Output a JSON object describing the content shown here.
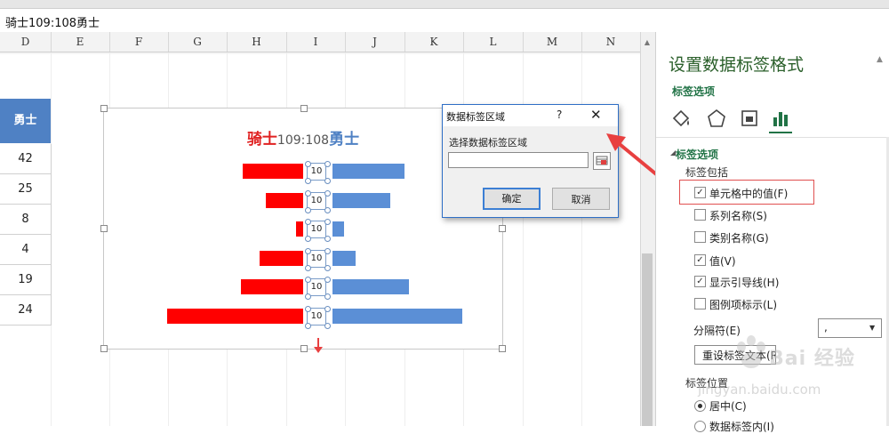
{
  "formula_bar": {
    "text": "骑士109:108勇士"
  },
  "columns": [
    "D",
    "E",
    "F",
    "G",
    "H",
    "I",
    "J",
    "K",
    "L",
    "M",
    "N"
  ],
  "sheet": {
    "header_cell": "勇士",
    "values": [
      "42",
      "25",
      "8",
      "4",
      "19",
      "24"
    ]
  },
  "chart": {
    "title_left": "骑士",
    "title_mid": "109:108",
    "title_right": "勇士",
    "label_text": "10"
  },
  "chart_data": {
    "type": "bar",
    "title": "骑士109:108勇士",
    "orientation": "horizontal-butterfly",
    "series": [
      {
        "name": "骑士",
        "color": "#ff0000",
        "values": [
          26,
          16,
          3,
          19,
          27,
          59
        ]
      },
      {
        "name": "勇士",
        "color": "#5b8fd6",
        "values": [
          31,
          25,
          5,
          10,
          33,
          56
        ]
      }
    ],
    "data_labels": [
      "10",
      "10",
      "10",
      "10",
      "10",
      "10"
    ],
    "legend": "none",
    "grid": false
  },
  "dialog": {
    "title": "数据标签区域",
    "help": "?",
    "close": "✕",
    "prompt": "选择数据标签区域",
    "input_value": "",
    "ok": "确定",
    "cancel": "取消"
  },
  "panel": {
    "title": "设置数据标签格式",
    "subtab": "标签选项",
    "section": "标签选项",
    "include_label": "标签包括",
    "options": [
      {
        "label": "单元格中的值(F)",
        "checked": true
      },
      {
        "label": "系列名称(S)",
        "checked": false
      },
      {
        "label": "类别名称(G)",
        "checked": false
      },
      {
        "label": "值(V)",
        "checked": true
      },
      {
        "label": "显示引导线(H)",
        "checked": true
      },
      {
        "label": "图例项标示(L)",
        "checked": false
      }
    ],
    "separator_label": "分隔符(E)",
    "separator_value": ",",
    "reset_label": "重设标签文本(R)",
    "position_label": "标签位置",
    "position_options": [
      {
        "label": "居中(C)",
        "selected": true
      },
      {
        "label": "数据标签内(I)",
        "selected": false
      }
    ]
  },
  "watermark": {
    "brand": "Bai 经验",
    "url": "jingyan.baidu.com"
  },
  "colors": {
    "accent": "#217346",
    "dialog_border": "#2f6fc6",
    "arrow": "#e84040",
    "header_blue": "#4f81c4"
  }
}
